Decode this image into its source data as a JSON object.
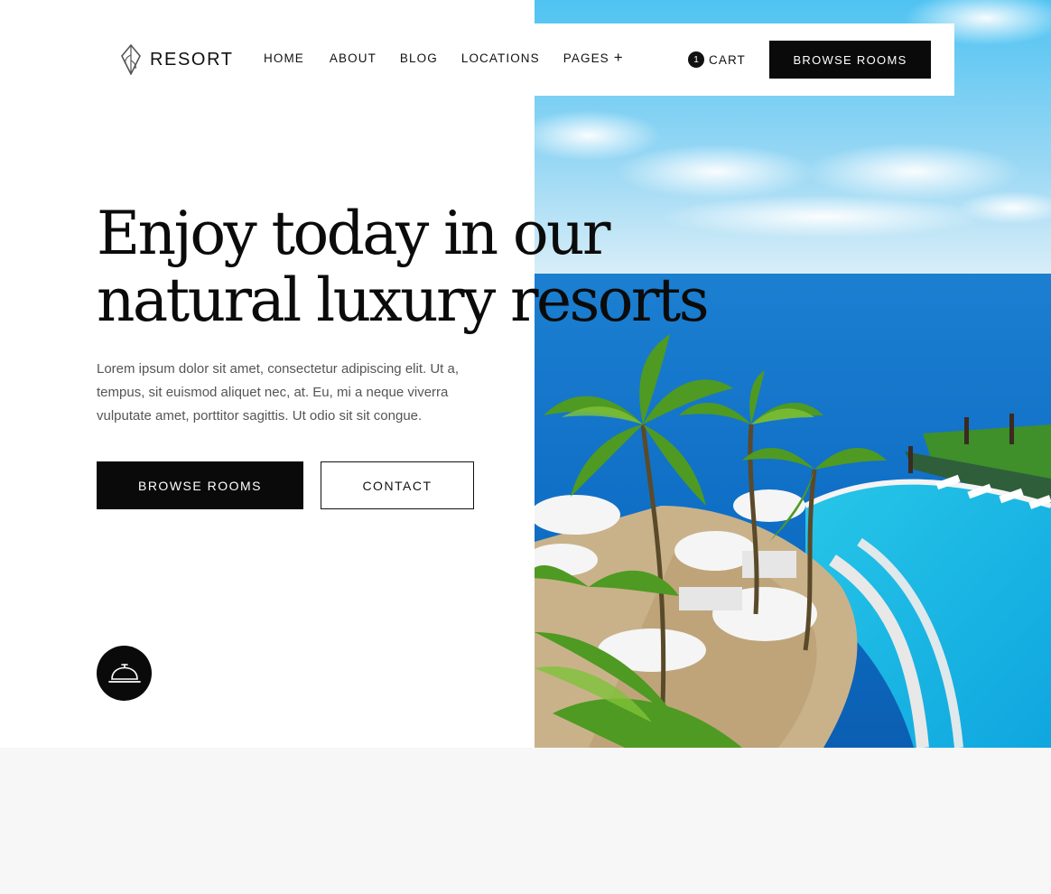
{
  "brand": {
    "name": "RESORT",
    "logo_icon": "leaf-diamond-icon"
  },
  "nav": {
    "items": [
      {
        "label": "HOME"
      },
      {
        "label": "ABOUT"
      },
      {
        "label": "BLOG"
      },
      {
        "label": "LOCATIONS"
      },
      {
        "label": "PAGES",
        "icon": "plus-icon"
      }
    ],
    "cart": {
      "count": "1",
      "label": "CART"
    },
    "cta_label": "BROWSE ROOMS"
  },
  "hero": {
    "headline_line1": "Enjoy today in our",
    "headline_line2": "natural luxury resorts",
    "body": "Lorem ipsum dolor sit amet, consectetur adipiscing elit. Ut a, tempus, sit euismod aliquet nec, at. Eu, mi a neque viverra vulputate amet, porttitor sagittis. Ut odio sit sit congue.",
    "primary_button": "BROWSE ROOMS",
    "secondary_button": "CONTACT",
    "bell_icon": "service-bell-icon",
    "image": "resort-pool-ocean-photo"
  },
  "colors": {
    "accent": "#0a0a0a",
    "background": "#ffffff",
    "lower_section": "#f7f7f7",
    "body_text": "#555555"
  }
}
